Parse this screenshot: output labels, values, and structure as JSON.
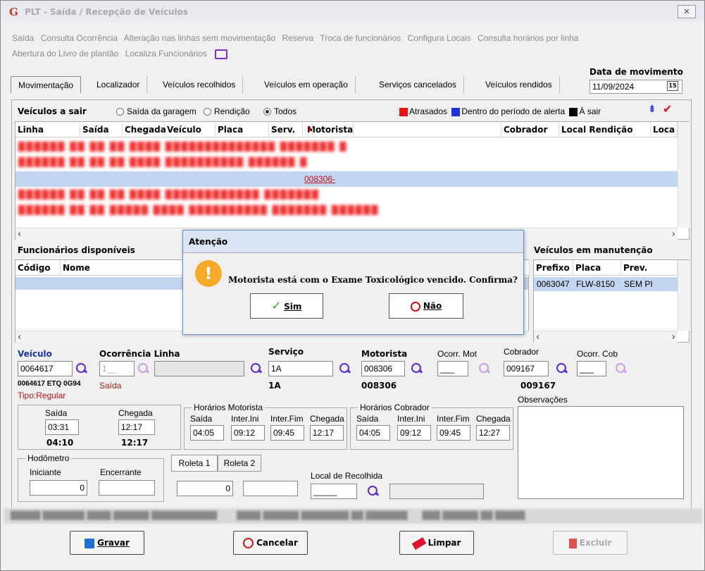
{
  "window": {
    "logo": "G",
    "title": "PLT - Saída / Recepção de Veículos",
    "close_glyph": "✕"
  },
  "menu": [
    "Saída",
    "Consulta Ocorrência",
    "Alteração nas linhas sem movimentação",
    "Reserva",
    "Troca de funcionários",
    "Configura Locais",
    "Consulta horários por linha",
    "Abertura do Livro de plantão",
    "Localiza Funcionários"
  ],
  "tabs": [
    "Movimentação",
    "Localizador",
    "Veículos recolhidos",
    "Veículos em operação",
    "Serviços cancelados",
    "Veículos rendidos"
  ],
  "date": {
    "label": "Data de movimento",
    "value": "11/09/2024",
    "cal": "15"
  },
  "vehicles": {
    "title": "Veículos a sair",
    "filters": [
      "Saída da garagem",
      "Rendição",
      "Todos"
    ],
    "selected_filter": "Todos",
    "legend": [
      {
        "label": "Atrasados",
        "color": "#ee1111"
      },
      {
        "label": "Dentro do período de alerta",
        "color": "#1a33d9"
      },
      {
        "label": "À sair",
        "color": "#000000"
      }
    ],
    "columns": [
      "Linha",
      "Saída",
      "Chegada",
      "Veículo",
      "Placa",
      "Serv.",
      "Motorista",
      "Cobrador",
      "Local Rendição",
      "Loca"
    ],
    "sort_arrow": "1",
    "highlight_text": "008306-"
  },
  "funcionarios": {
    "title": "Funcionários disponíveis",
    "columns": [
      "Código",
      "Nome"
    ]
  },
  "manutencao": {
    "title": "Veículos em manutenção",
    "columns": [
      "Prefixo",
      "Placa",
      "Prev."
    ],
    "rows": [
      [
        "0063047",
        "FLW-8150",
        "SEM PI"
      ]
    ]
  },
  "form": {
    "veiculo_label": "Veículo",
    "veiculo": "0064617",
    "veiculo_info": "0064617 ETQ 0G94",
    "tipo": "Tipo:Regular",
    "ocorrencia_label": "Ocorrência Linha",
    "ocorrencia": "1__",
    "ocorrencia_status": "Saída",
    "servico_label": "Serviço",
    "servico": "1A",
    "servico_sub": "1A",
    "motorista_label": "Motorista",
    "motorista": "008306",
    "motorista_sub": "008306",
    "ocorr_mot_label": "Ocorr. Mot",
    "ocorr_mot": "___",
    "cobrador_label": "Cobrador",
    "cobrador": "009167",
    "cobrador_sub": "009167",
    "ocorr_cob_label": "Ocorr. Cob",
    "ocorr_cob": "___",
    "saida_label": "Saída",
    "saida": "03:31",
    "saida_sub": "04:10",
    "chegada_label": "Chegada",
    "chegada": "12:17",
    "chegada_sub": "12:17",
    "hm_title": "Horários Motorista",
    "hc_title": "Horários Cobrador",
    "h_cols": [
      "Saída",
      "Inter.Ini",
      "Inter.Fim",
      "Chegada"
    ],
    "hm": [
      "04:05",
      "09:12",
      "09:45",
      "12:17"
    ],
    "hc": [
      "04:05",
      "09:12",
      "09:45",
      "12:27"
    ],
    "obs_label": "Observações",
    "hodometro": "Hodômetro",
    "iniciante": "Iniciante",
    "encerrante": "Encerrante",
    "hod_ini": "0",
    "roleta1": "Roleta 1",
    "roleta2": "Roleta 2",
    "rol_ini": "0",
    "local_label": "Local de Recolhida",
    "local_value": "_____"
  },
  "buttons": {
    "gravar": "Gravar",
    "cancelar": "Cancelar",
    "limpar": "Limpar",
    "excluir": "Excluir"
  },
  "dialog": {
    "title": "Atenção",
    "icon": "!",
    "message": "Motorista está com o Exame Toxicológico vencido. Confirma?",
    "yes": "Sim",
    "no": "Não"
  }
}
